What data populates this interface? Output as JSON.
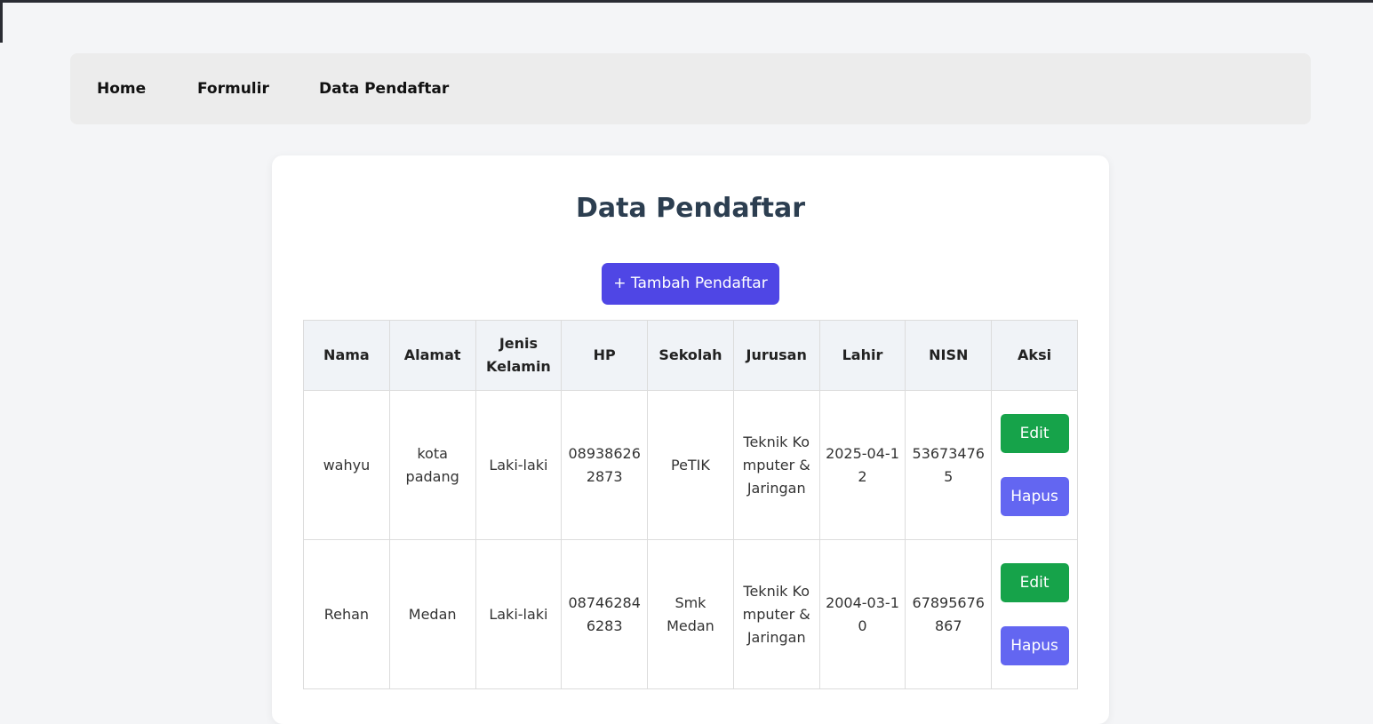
{
  "nav": {
    "items": [
      {
        "label": "Home"
      },
      {
        "label": "Formulir"
      },
      {
        "label": "Data Pendaftar"
      }
    ]
  },
  "page": {
    "title": "Data Pendaftar",
    "add_button_label": "+ Tambah Pendaftar"
  },
  "table": {
    "headers": [
      "Nama",
      "Alamat",
      "Jenis Kelamin",
      "HP",
      "Sekolah",
      "Jurusan",
      "Lahir",
      "NISN",
      "Aksi"
    ],
    "rows": [
      {
        "nama": "wahyu",
        "alamat": "kota padang",
        "jenis_kelamin": "Laki-laki",
        "hp": "089386262873",
        "sekolah": "PeTIK",
        "jurusan": "Teknik Komputer & Jaringan",
        "lahir": "2025-04-12",
        "nisn": "536734765",
        "edit_label": "Edit",
        "hapus_label": "Hapus"
      },
      {
        "nama": "Rehan",
        "alamat": "Medan",
        "jenis_kelamin": "Laki-laki",
        "hp": "087462846283",
        "sekolah": "Smk Medan",
        "jurusan": "Teknik Komputer & Jaringan",
        "lahir": "2004-03-10",
        "nisn": "67895676867",
        "edit_label": "Edit",
        "hapus_label": "Hapus"
      }
    ]
  },
  "colors": {
    "page_bg": "#f4f5f7",
    "navbar_bg": "#ececec",
    "title": "#2c3e50",
    "add_button": "#4f46e5",
    "edit_button": "#16a34a",
    "hapus_button": "#6366f1",
    "table_header_bg": "#f0f3f7"
  }
}
